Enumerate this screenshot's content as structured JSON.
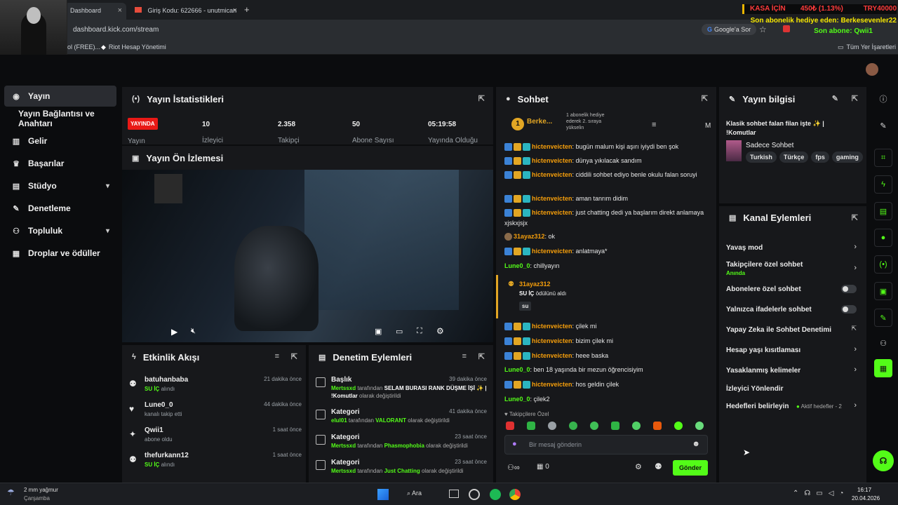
{
  "browser": {
    "tabs": [
      {
        "label": "Dashboard"
      },
      {
        "label": "Giriş Kodu: 622666 - unutmican"
      }
    ],
    "new_tab": "+",
    "url": "dashboard.kick.com/stream",
    "google_ask": "Google'a Sor",
    "bookmarks": [
      "ol (FREE)...",
      "Riot Hesap Yönetimi"
    ],
    "all_bookmarks": "Tüm Yer İşaretleri"
  },
  "overlay": {
    "ticker_left": "KASA İÇİN",
    "ticker_mid": "450₺ (1.13%)",
    "ticker_right": "TRY40000",
    "gift_line": "Son abonelik hediye eden: Berkesevenler22",
    "sub_line": "Son abone: Qwii1"
  },
  "sidebar": {
    "items": [
      {
        "label": "Yayın",
        "icon": "broadcast-icon"
      },
      {
        "label": "Yayın Bağlantısı ve Anahtarı",
        "icon": ""
      },
      {
        "label": "Gelir",
        "icon": "chart-icon"
      },
      {
        "label": "Başarılar",
        "icon": "trophy-icon"
      },
      {
        "label": "Stüdyo",
        "icon": "studio-icon"
      },
      {
        "label": "Denetleme",
        "icon": "wrench-icon"
      },
      {
        "label": "Topluluk",
        "icon": "community-icon"
      },
      {
        "label": "Droplar ve ödüller",
        "icon": "drops-icon"
      }
    ]
  },
  "stats": {
    "title": "Yayın İstatistikleri",
    "live_badge": "YAYINDA",
    "live_label": "Yayın",
    "viewers_v": "10",
    "viewers_l": "İzleyici",
    "followers_v": "2.358",
    "followers_l": "Takipçi",
    "subs_v": "50",
    "subs_l": "Abone Sayısı",
    "uptime_v": "05:19:58",
    "uptime_l": "Yayında Olduğu"
  },
  "preview": {
    "title": "Yayın Ön İzlemesi"
  },
  "activity": {
    "title": "Etkinlik Akışı",
    "items": [
      {
        "name": "batuhanbaba",
        "sub_green": "SU İÇ",
        "sub": " alındı",
        "time": "21 dakika önce"
      },
      {
        "name": "Lune0_0",
        "sub_green": "",
        "sub": "kanalı takip etti",
        "time": "44 dakika önce"
      },
      {
        "name": "Qwii1",
        "sub_green": "",
        "sub": "abone oldu",
        "time": "1 saat önce"
      },
      {
        "name": "thefurkann12",
        "sub_green": "SU İÇ",
        "sub": " alındı",
        "time": "1 saat önce"
      }
    ]
  },
  "moderation": {
    "title": "Denetim Eylemleri",
    "items": [
      {
        "name": "Başlık",
        "time": "39 dakika önce",
        "user": "Mertssxd",
        "mid": " tarafından ",
        "value": "SELAM BURASI RANK DÜŞME İŞİ ✨ | !Komutlar",
        "end": " olarak değiştirildi"
      },
      {
        "name": "Kategori",
        "time": "41 dakika önce",
        "user": "elul01",
        "mid": " tarafından ",
        "value": "VALORANT",
        "end": " olarak değiştirildi"
      },
      {
        "name": "Kategori",
        "time": "23 saat önce",
        "user": "Mertssxd",
        "mid": " tarafından ",
        "value": "Phasmophobia",
        "end": " olarak değiştirildi"
      },
      {
        "name": "Kategori",
        "time": "23 saat önce",
        "user": "Mertssxd",
        "mid": " tarafından ",
        "value": "Just Chatting",
        "end": " olarak değiştirildi"
      }
    ]
  },
  "chat": {
    "title": "Sohbet",
    "pinned_user": "Berke...",
    "pinned_count": "1",
    "pinned_text": "1 abonelik hediye ederek 2. sıraya yükselin",
    "pinned_m": "M",
    "messages": [
      {
        "nick": "hictenveicten",
        "text": ": bugün malum kişi aşırı iyiydi ben şok"
      },
      {
        "nick": "hictenveicten",
        "text": ": dünya yıkılacak sandım"
      },
      {
        "nick": "hictenveicten",
        "text": ": ciddili sohbet ediyo benle okulu falan soruyi"
      },
      {
        "nick": "hictenveicten",
        "text": ": aman tanrım didim"
      },
      {
        "nick": "hictenveicten",
        "text": ": just chatting dedi ya başlarım direkt anlamaya xjskxjsjx"
      },
      {
        "nick": "31ayaz312",
        "text": ": ok"
      },
      {
        "nick": "hictenveicten",
        "text": ": anlatmaya*"
      },
      {
        "nick": "Lune0_0",
        "text": ": chillyayın"
      },
      {
        "nick": "hictenveicten",
        "text": ": çilek mi"
      },
      {
        "nick": "hictenveicten",
        "text": ": bizim çilek mi"
      },
      {
        "nick": "hictenveicten",
        "text": ": heee baska"
      },
      {
        "nick": "Lune0_0",
        "text": ": ben 18 yaşında bir mezun öğrencisiyim"
      },
      {
        "nick": "hictenveicten",
        "text": ": hos geldin çilek"
      },
      {
        "nick": "Lune0_0",
        "text": ": çilek2"
      }
    ],
    "reward_user": "31ayaz312",
    "reward_green": "SU İÇ",
    "reward_text": " ödülünü aldı",
    "reward_tag": "su",
    "followers_only": "Takipçilere Özel",
    "input_placeholder": "Bir mesaj gönderin",
    "points": "0",
    "send": "Gönder"
  },
  "info": {
    "title": "Yayın bilgisi",
    "stream_title": "Klasik sohbet falan filan işte ✨ | !Komutlar",
    "category": "Sadece Sohbet",
    "tags": [
      "Turkish",
      "Türkçe",
      "fps",
      "gaming"
    ]
  },
  "channel": {
    "title": "Kanal Eylemleri",
    "slow": "Yavaş mod",
    "followers": "Takipçilere özel sohbet",
    "followers_sub": "Anında",
    "subs": "Abonelere özel sohbet",
    "emotes": "Yalnızca ifadelerle sohbet",
    "ai": "Yapay Zeka ile Sohbet Denetimi",
    "age": "Hesap yaşı kısıtlaması",
    "banned": "Yasaklanmış kelimeler",
    "redirect": "İzleyici Yönlendir",
    "goals": "Hedefleri belirleyin",
    "goals_sub": "Aktif hedefler - 2"
  },
  "taskbar": {
    "weather": "2 mm yağmur",
    "day": "Çarşamba",
    "search": "Ara",
    "time": "16:17",
    "date": "20.04.2026"
  },
  "colors": {
    "kick_green": "#53fc18",
    "live_red": "#e91916",
    "panel": "#17181b"
  }
}
